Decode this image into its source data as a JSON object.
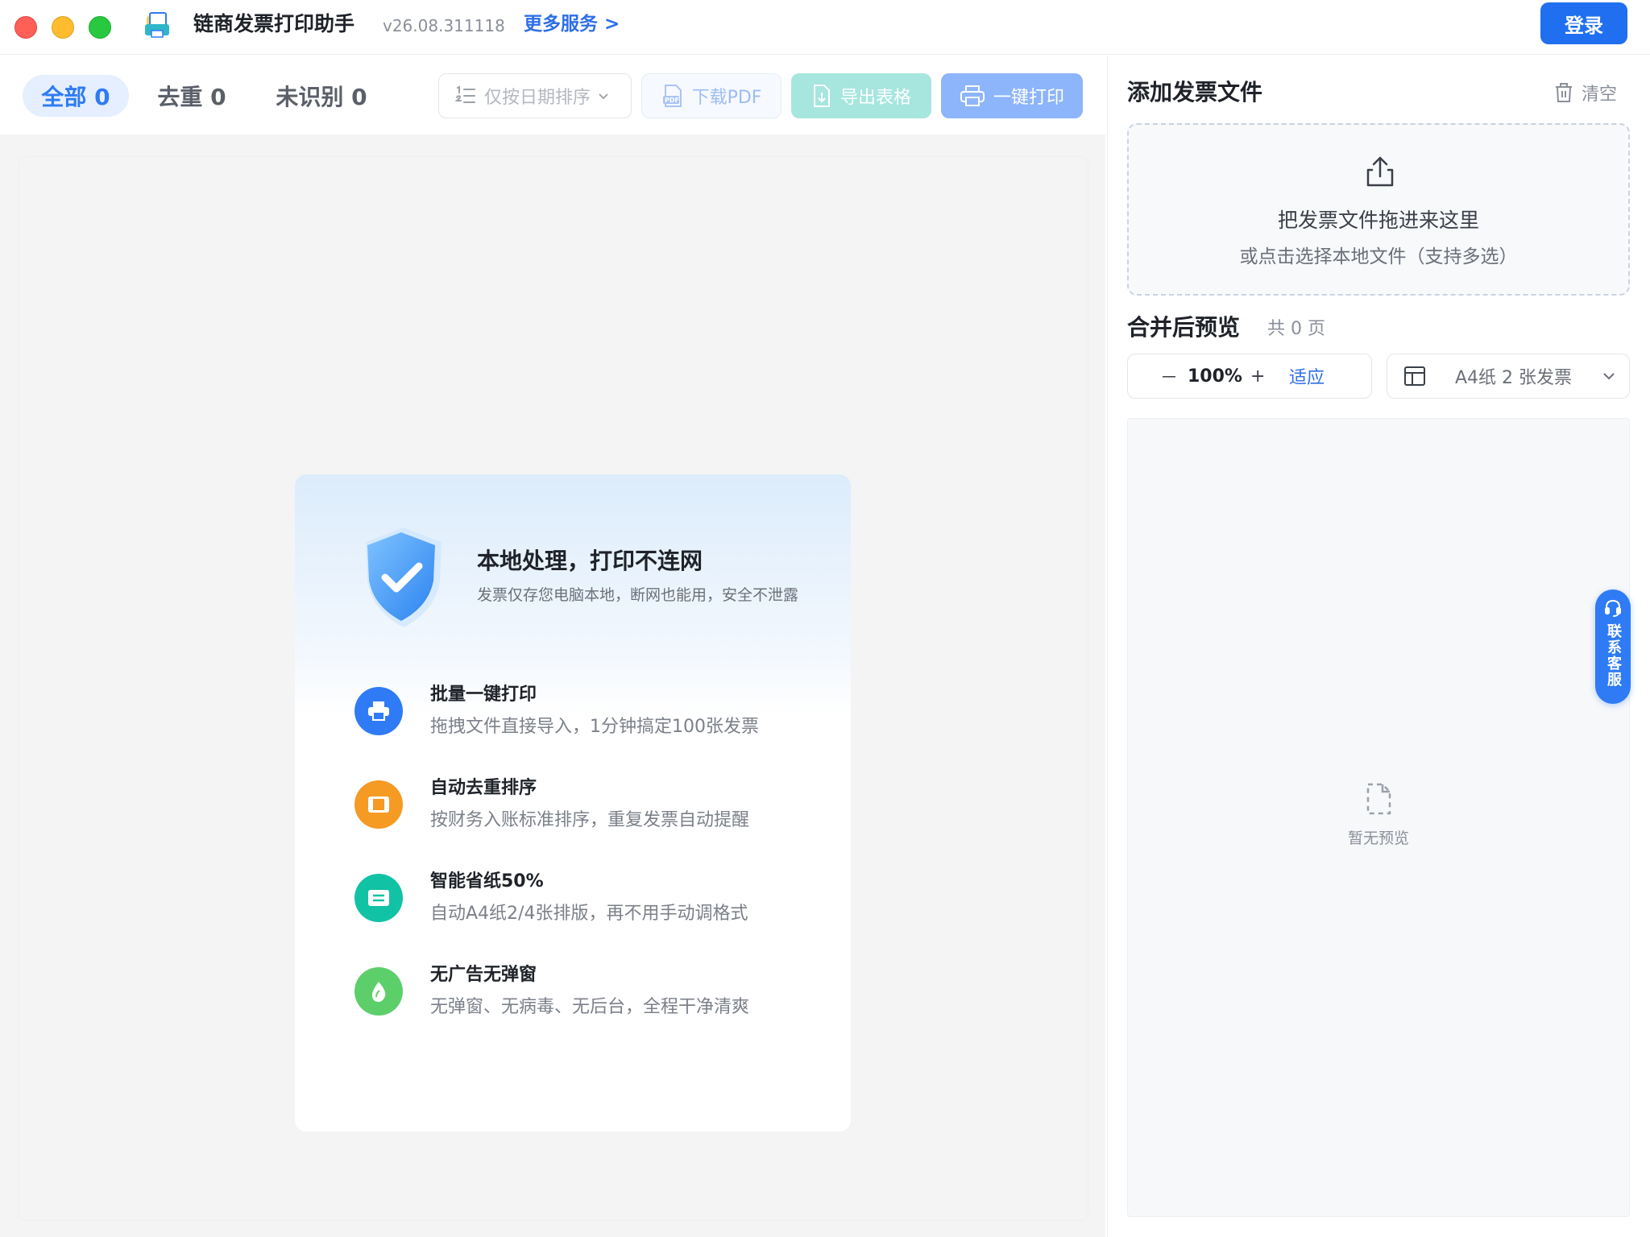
{
  "titlebar": {
    "app_name": "链商发票打印助手",
    "version": "v26.08.311118",
    "more_services": "更多服务 >",
    "login": "登录"
  },
  "tabs": [
    {
      "label": "全部 0",
      "active": true
    },
    {
      "label": "去重 0",
      "active": false
    },
    {
      "label": "未识别 0",
      "active": false
    }
  ],
  "toolbar": {
    "sort_label": "仅按日期排序",
    "download_pdf": "下载PDF",
    "export_table": "导出表格",
    "print_all": "一键打印"
  },
  "intro": {
    "title": "本地处理，打印不连网",
    "subtitle": "发票仅存您电脑本地，断网也能用，安全不泄露",
    "features": [
      {
        "icon": "printer-icon",
        "title": "批量一键打印",
        "desc": "拖拽文件直接导入，1分钟搞定100张发票",
        "color": "#2f7bf5"
      },
      {
        "icon": "stack-icon",
        "title": "自动去重排序",
        "desc": "按财务入账标准排序，重复发票自动提醒",
        "color": "#f59a23"
      },
      {
        "icon": "document-icon",
        "title": "智能省纸50%",
        "desc": "自动A4纸2/4张排版，再不用手动调格式",
        "color": "#12c2a4"
      },
      {
        "icon": "leaf-icon",
        "title": "无广告无弹窗",
        "desc": "无弹窗、无病毒、无后台，全程干净清爽",
        "color": "#5ccf6b"
      }
    ]
  },
  "right": {
    "add_title": "添加发票文件",
    "clear": "清空",
    "drop_main": "把发票文件拖进来这里",
    "drop_sub": "或点击选择本地文件（支持多选）",
    "preview_title": "合并后预览",
    "page_count": "共 0 页",
    "zoom_minus": "－",
    "zoom_value": "100%",
    "zoom_plus": "+",
    "zoom_fit": "适应",
    "layout_option": "A4纸 2 张发票",
    "empty_text": "暂无预览"
  },
  "support": {
    "label": "联系客服"
  },
  "colors": {
    "primary": "#1f6ff0",
    "accent_teal": "#a6e6df",
    "accent_print": "#8db5fb"
  }
}
